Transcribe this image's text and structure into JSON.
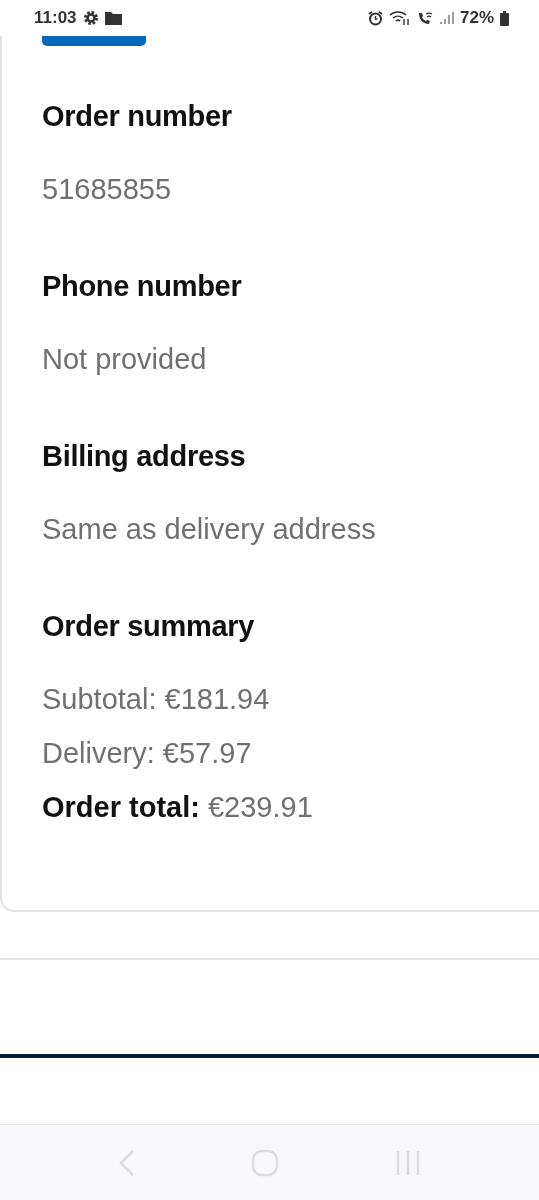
{
  "status_bar": {
    "time": "11:03",
    "battery": "72%"
  },
  "sections": [
    {
      "heading": "Order number",
      "lines": [
        "51685855"
      ]
    },
    {
      "heading": "Phone number",
      "lines": [
        "Not provided"
      ]
    },
    {
      "heading": "Billing address",
      "lines": [
        "Same as delivery address"
      ]
    },
    {
      "heading": "Order summary",
      "lines": [
        "Subtotal: €181.94",
        "Delivery: €57.97",
        "**Order total:** €239.91"
      ]
    }
  ]
}
